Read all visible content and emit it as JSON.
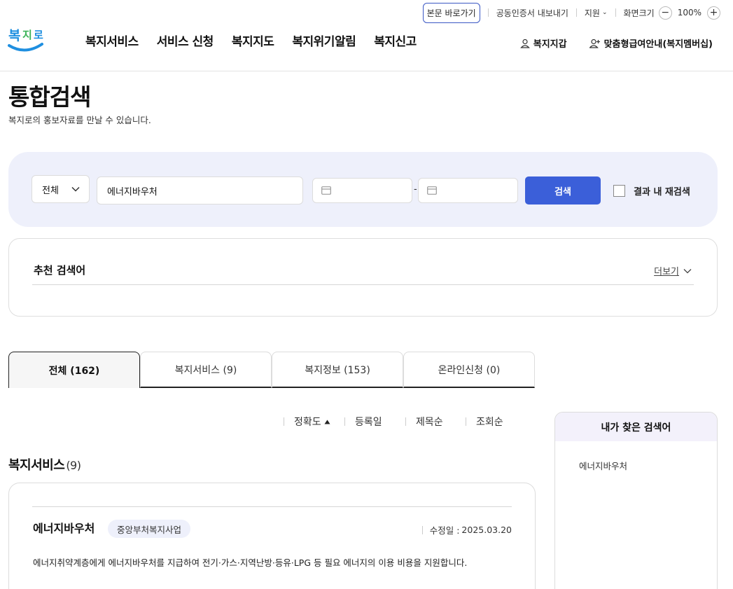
{
  "utility": {
    "skip_link": "본문 바로가기",
    "cert_export": "공동인증서 내보내기",
    "support": "지원",
    "screen_size": "화면크기",
    "zoom_minus": "−",
    "zoom_value": "100%",
    "zoom_plus": "+"
  },
  "logo": {
    "text": "복지로"
  },
  "nav": {
    "items": [
      "복지서비스",
      "서비스 신청",
      "복지지도",
      "복지위기알림",
      "복지신고"
    ]
  },
  "header_right": {
    "wallet": "복지지갑",
    "membership": "맞춤형급여안내(복지멤버십)"
  },
  "page": {
    "title": "통합검색",
    "description": "복지로의 홍보자료를 만날 수 있습니다."
  },
  "search": {
    "category_selected": "전체",
    "keyword_value": "에너지바우처",
    "date_from": "",
    "date_to": "",
    "date_separator": "-",
    "button": "검색",
    "research_label": "결과 내 재검색"
  },
  "recommend": {
    "title": "추천 검색어",
    "more": "더보기"
  },
  "tabs": [
    {
      "label": "전체 (162)"
    },
    {
      "label": "복지서비스 (9)"
    },
    {
      "label": "복지정보 (153)"
    },
    {
      "label": "온라인신청 (0)"
    }
  ],
  "sort": {
    "accuracy": "정확도",
    "date": "등록일",
    "title": "제목순",
    "views": "조회순"
  },
  "section": {
    "title": "복지서비스",
    "count": "(9)"
  },
  "result": {
    "title": "에너지바우처",
    "badge": "중앙부처복지사업",
    "modified_label": "수정일 :",
    "modified_date": "2025.03.20",
    "description": "에너지취약계층에게 에너지바우처를 지급하여 전기·가스·지역난방·등유·LPG 등 필요 에너지의 이용 비용을 지원합니다."
  },
  "side": {
    "title": "내가 찾은 검색어",
    "items": [
      "에너지바우처"
    ]
  },
  "colors": {
    "primary": "#3b5fd9",
    "search_bg": "#eef0fb",
    "logo_blue": "#1f8fe0",
    "logo_green": "#3db35a"
  }
}
